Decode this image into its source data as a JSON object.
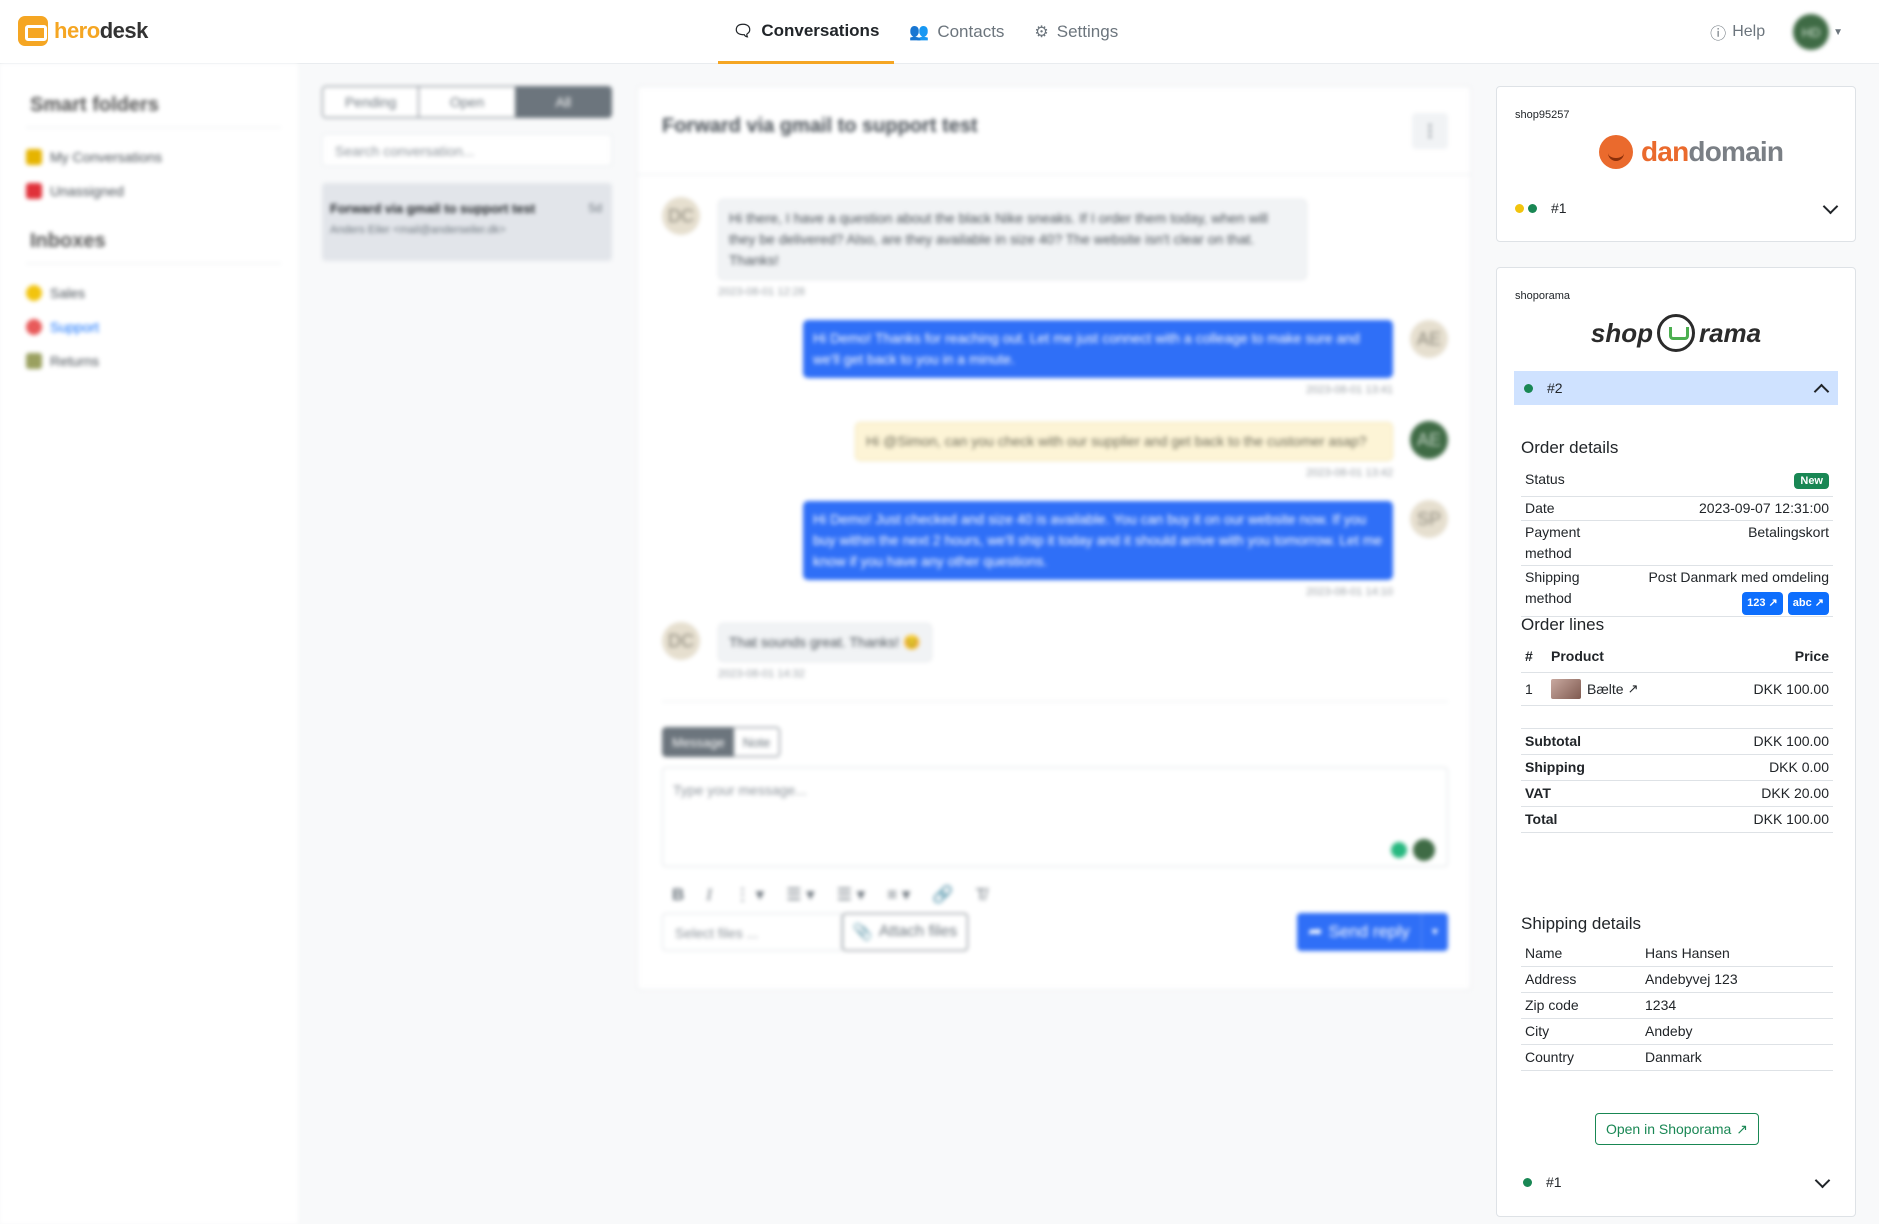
{
  "brand": {
    "part1": "hero",
    "part2": "desk"
  },
  "nav": {
    "items": [
      {
        "label": "Conversations",
        "icon": "comments-icon"
      },
      {
        "label": "Contacts",
        "icon": "users-icon"
      },
      {
        "label": "Settings",
        "icon": "gear-icon"
      }
    ],
    "help": "Help",
    "avatar": "HD"
  },
  "sidebar": {
    "smart_folders_title": "Smart folders",
    "smart_folders": [
      {
        "label": "My Conversations",
        "color": "#e6b400"
      },
      {
        "label": "Unassigned",
        "color": "#e0313a"
      }
    ],
    "inboxes_title": "Inboxes",
    "inboxes": [
      {
        "label": "Sales",
        "color": "#f2c40e"
      },
      {
        "label": "Support",
        "color": "#e85a5a"
      },
      {
        "label": "Returns",
        "color": "#9aa060"
      }
    ]
  },
  "conv_list": {
    "filters": [
      "Pending",
      "Open",
      "All"
    ],
    "search_placeholder": "Search conversation...",
    "items": [
      {
        "title": "Forward via gmail to support test",
        "time": "5d",
        "sender": "Anders Eiler <mail@anderseiler.dk>"
      }
    ]
  },
  "conversation": {
    "title": "Forward via gmail to support test",
    "messages": [
      {
        "avatar": "DC",
        "text": "Hi there, I have a question about the black Nike sneaks. If I order them today, when will they be delivered? Also, are they available in size 40? The website isn't clear on that. Thanks!",
        "time": "2023-08-01 12:28"
      },
      {
        "avatar": "AE",
        "text": "Hi Demo! Thanks for reaching out. Let me just connect with a colleage to make sure and we'll get back to you in a minute.",
        "time": "2023-08-01 13:41"
      },
      {
        "avatar": "AE",
        "text": "Hi @Simon, can you check with our supplier and get back to the customer asap?",
        "time": "2023-08-01 13:42"
      },
      {
        "avatar": "SP",
        "text": "Hi Demo! Just checked and size 40 is available. You can buy it on our website now. If you buy within the next 2 hours, we'll ship it today and it should arrive with you tomorrow. Let me know if you have any other questions.",
        "time": "2023-08-01 14:10"
      },
      {
        "avatar": "DC",
        "text": "That sounds great. Thanks! 😊",
        "time": "2023-08-01 14:32"
      }
    ],
    "compose_tabs": [
      "Message",
      "Note"
    ],
    "placeholder": "Type your message...",
    "select_files": "Select files ...",
    "attach": "Attach files",
    "send": "Send reply"
  },
  "shop1": {
    "tag": "shop95257",
    "logo_a": "dan",
    "logo_b": "domain",
    "order": "#1"
  },
  "shop2": {
    "tag": "shoporama",
    "logo_a": "shop",
    "logo_b": "rama",
    "order_active": "#2",
    "order_details_title": "Order details",
    "status_label": "Status",
    "status_value": "New",
    "date_label": "Date",
    "date_value": "2023-09-07 12:31:00",
    "payment_label": "Payment method",
    "payment_value": "Betalingskort",
    "shipping_method_label": "Shipping method",
    "shipping_method_value": "Post Danmark med omdeling",
    "tracking_badges": [
      "123",
      "abc"
    ],
    "order_lines_title": "Order lines",
    "lines_head": {
      "num": "#",
      "product": "Product",
      "price": "Price"
    },
    "lines": [
      {
        "num": "1",
        "product": "Bælte",
        "price": "DKK 100.00"
      }
    ],
    "subtotal_label": "Subtotal",
    "subtotal": "DKK 100.00",
    "shipping_label": "Shipping",
    "shipping": "DKK 0.00",
    "vat_label": "VAT",
    "vat": "DKK 20.00",
    "total_label": "Total",
    "total": "DKK 100.00",
    "shipping_details_title": "Shipping details",
    "name_label": "Name",
    "name": "Hans Hansen",
    "address_label": "Address",
    "address": "Andebyvej 123",
    "zip_label": "Zip code",
    "zip": "1234",
    "city_label": "City",
    "city": "Andeby",
    "country_label": "Country",
    "country": "Danmark",
    "open_button": "Open in Shoporama",
    "order_bottom": "#1"
  }
}
